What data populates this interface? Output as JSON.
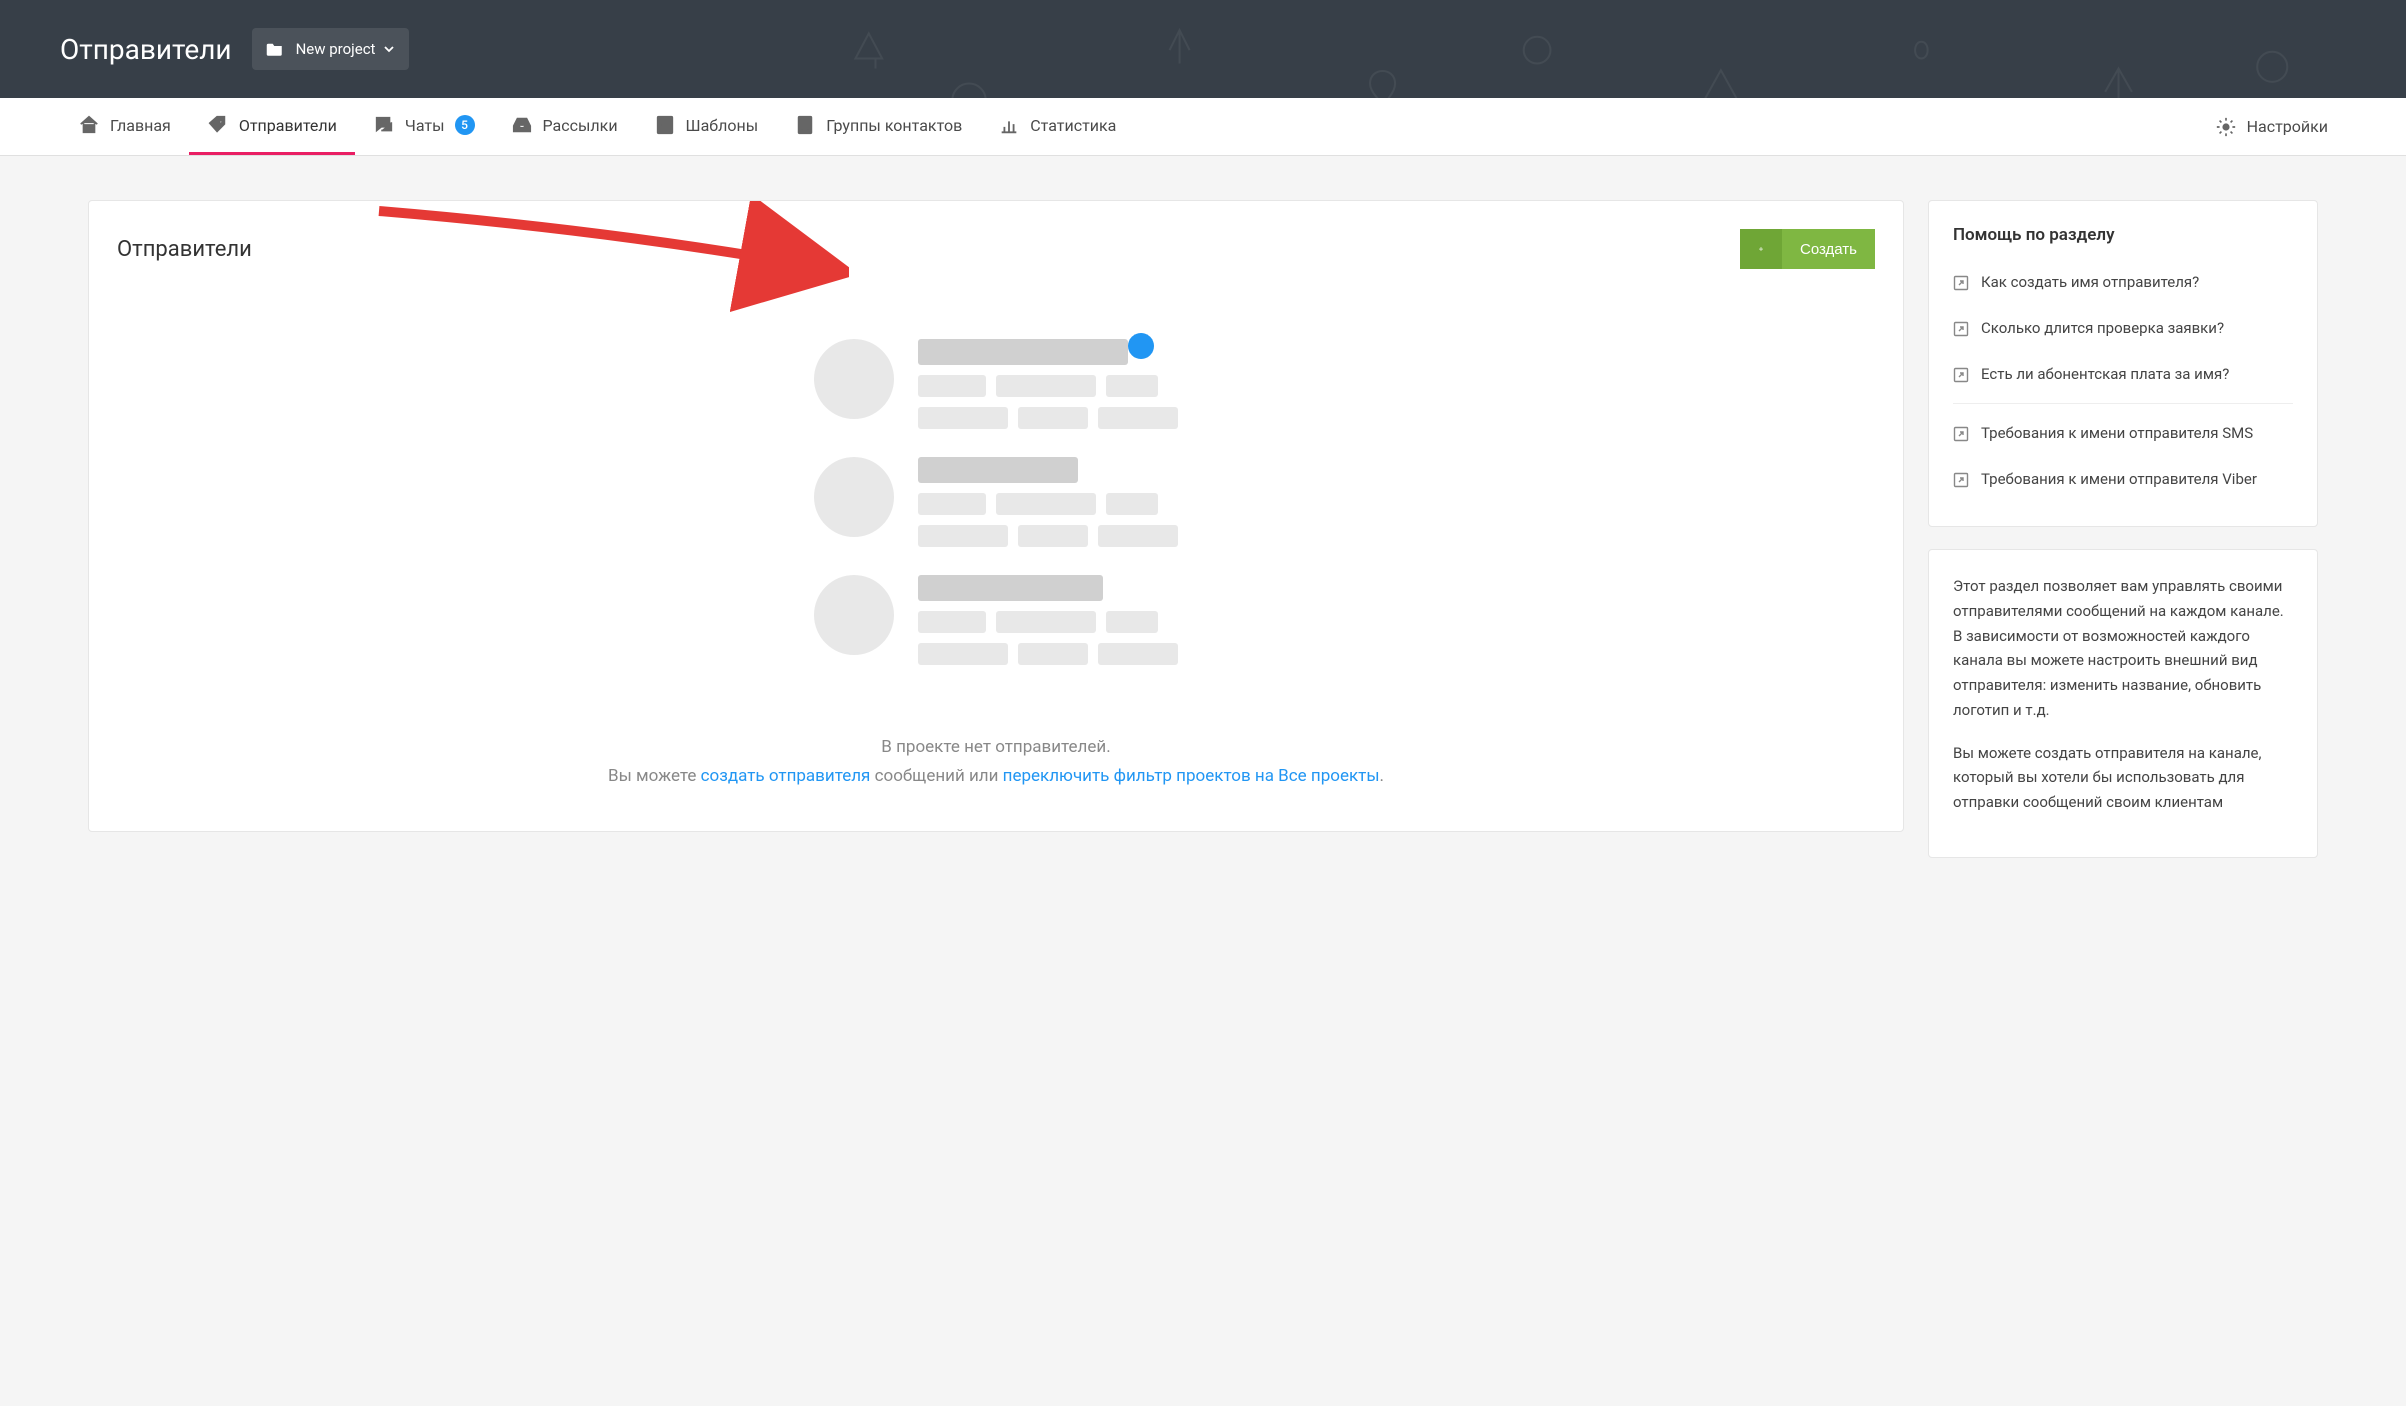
{
  "header": {
    "title": "Отправители",
    "project": "New project"
  },
  "nav": {
    "home": "Главная",
    "senders": "Отправители",
    "chats": "Чаты",
    "chats_badge": "5",
    "mailings": "Рассылки",
    "templates": "Шаблоны",
    "contact_groups": "Группы контактов",
    "statistics": "Статистика",
    "settings": "Настройки"
  },
  "main": {
    "title": "Отправители",
    "create_button": "Создать",
    "empty_line1": "В проекте нет отправителей.",
    "empty_prefix": "Вы можете ",
    "empty_link1": "создать отправителя",
    "empty_mid": " сообщений или ",
    "empty_link2": "переключить фильтр проектов на Все проекты",
    "empty_suffix": "."
  },
  "help": {
    "title": "Помощь по разделу",
    "items_a": [
      "Как создать имя отправителя?",
      "Сколько длится проверка заявки?",
      "Есть ли абонентская плата за имя?"
    ],
    "items_b": [
      "Требования к имени отправителя SMS",
      "Требования к имени отправителя Viber"
    ]
  },
  "info": {
    "p1": "Этот раздел позволяет вам управлять своими отправителями сообщений на каждом канале. В зависимости от возможностей каждого канала вы можете настроить внешний вид отправителя: изменить название, обновить логотип и т.д.",
    "p2": "Вы можете создать отправителя на канале, который вы хотели бы использовать для отправки сообщений своим клиентам"
  }
}
